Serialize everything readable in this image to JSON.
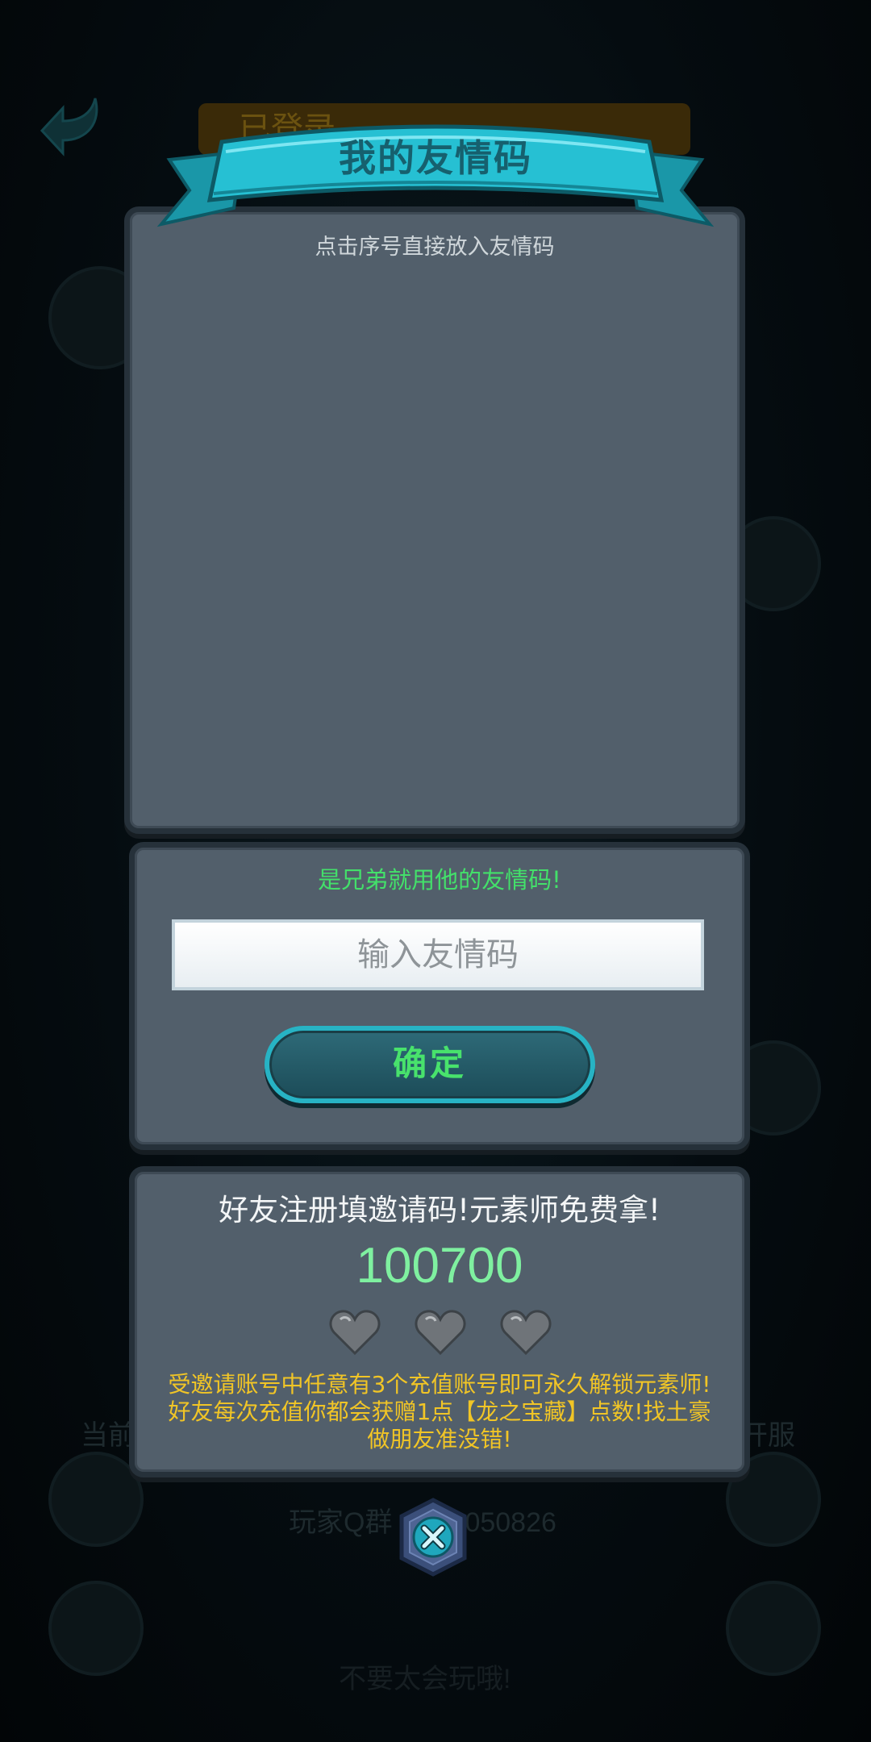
{
  "background": {
    "title_partial": "已登录",
    "qq_group_partial": "玩家Q群",
    "qq_number_partial": "050826",
    "left_partial": "当前",
    "right_partial": "开服",
    "bottom_partial": "不要太会玩哦!"
  },
  "dialog": {
    "title": "我的友情码",
    "hint": "点击序号直接放入友情码"
  },
  "input_panel": {
    "note": "是兄弟就用他的友情码!",
    "placeholder": "输入友情码",
    "confirm_label": "确定"
  },
  "invite_panel": {
    "title": "好友注册填邀请码!元素师免费拿!",
    "code": "100700",
    "hearts_filled": 0,
    "hearts_total": 3,
    "description": "受邀请账号中任意有3个充值账号即可永久解锁元素师!好友每次充值你都会获赠1点【龙之宝藏】点数!找土豪做朋友准没错!"
  },
  "colors": {
    "panel": "#525f6b",
    "ribbon": "#1fb6c9",
    "accent_green": "#48e26c",
    "code_green": "#7ff0a0",
    "warning_yellow": "#f1c526"
  },
  "icons": {
    "back": "back-arrow-icon",
    "heart": "heart-icon",
    "close": "close-x-icon"
  }
}
